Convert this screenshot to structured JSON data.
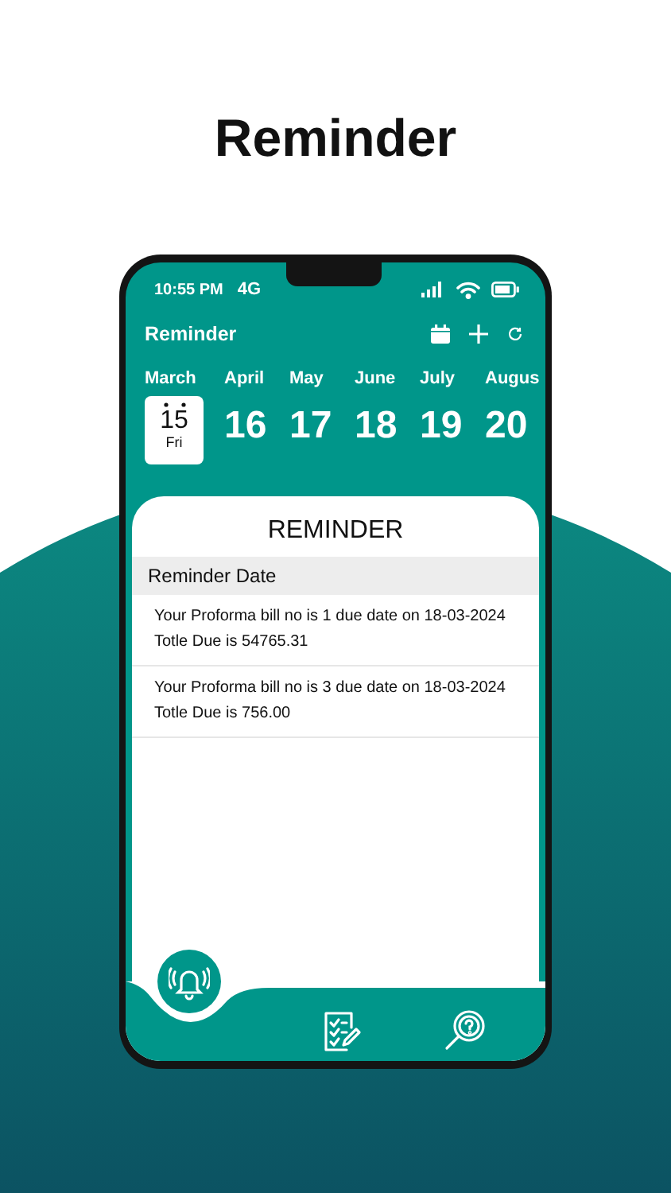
{
  "headline": "Reminder",
  "status_bar": {
    "time": "10:55 PM",
    "network": "4G"
  },
  "app_bar": {
    "title": "Reminder"
  },
  "dates": [
    {
      "month": "March",
      "day": "15",
      "weekday": "Fri",
      "selected": true
    },
    {
      "month": "April",
      "day": "16",
      "selected": false
    },
    {
      "month": "May",
      "day": "17",
      "selected": false
    },
    {
      "month": "June",
      "day": "18",
      "selected": false
    },
    {
      "month": "July",
      "day": "19",
      "selected": false
    },
    {
      "month": "Augus",
      "day": "20",
      "selected": false
    }
  ],
  "card": {
    "title": "REMINDER",
    "section": "Reminder Date",
    "items": [
      {
        "line1": "Your Proforma bill no is 1 due date on 18-03-2024",
        "line2": "Totle Due is 54765.31"
      },
      {
        "line1": "Your Proforma bill no is 3 due date on 18-03-2024",
        "line2": "Totle Due is 756.00"
      }
    ]
  },
  "bottom_nav": [
    {
      "kind": "bell",
      "selected": true
    },
    {
      "kind": "checklist",
      "selected": false
    },
    {
      "kind": "help-search",
      "selected": false
    }
  ]
}
